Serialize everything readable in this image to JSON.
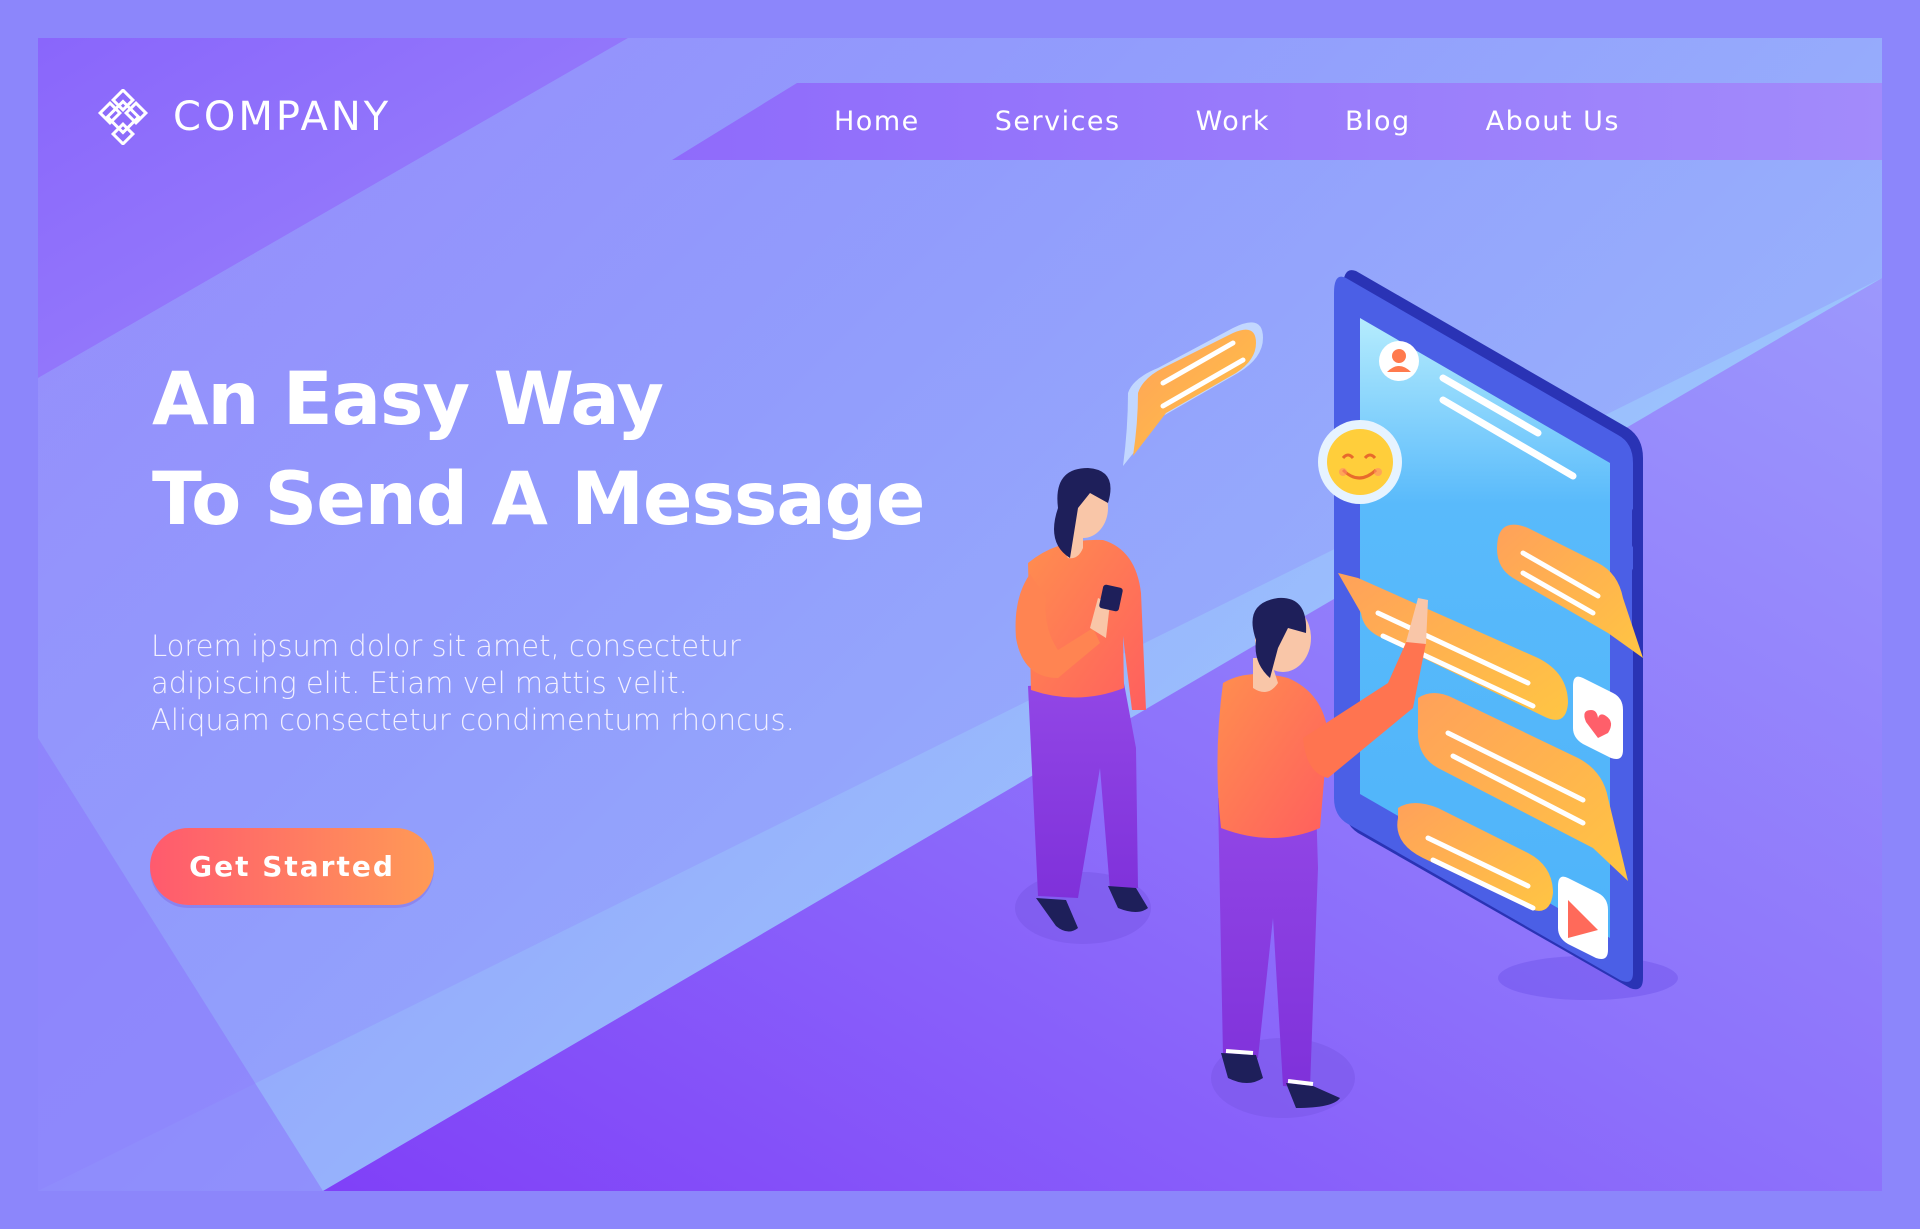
{
  "brand": {
    "name": "COMPANY",
    "logo_icon": "diamond-knot-icon"
  },
  "nav": {
    "items": [
      "Home",
      "Services",
      "Work",
      "Blog",
      "About Us"
    ]
  },
  "hero": {
    "title_line1": "An Easy Way",
    "title_line2": "To Send A Message",
    "desc_line1": "Lorem ipsum dolor sit amet, consectetur",
    "desc_line2": "adipiscing elit. Etiam vel mattis velit.",
    "desc_line3": "Aliquam consectetur condimentum rhoncus.",
    "cta_label": "Get Started"
  },
  "colors": {
    "border": "#8c86fb",
    "cta_start": "#ff5a6e",
    "cta_end": "#ff9a56",
    "phone_body": "#2b35b8",
    "phone_screen": "#47b6fb",
    "bubble": "#ffb347",
    "shirt": "#ff7a4d",
    "pants": "#8a3de0"
  },
  "illustration": {
    "icons": [
      "smiley-emoji-icon",
      "heart-icon",
      "send-arrow-icon",
      "user-avatar-icon"
    ]
  }
}
